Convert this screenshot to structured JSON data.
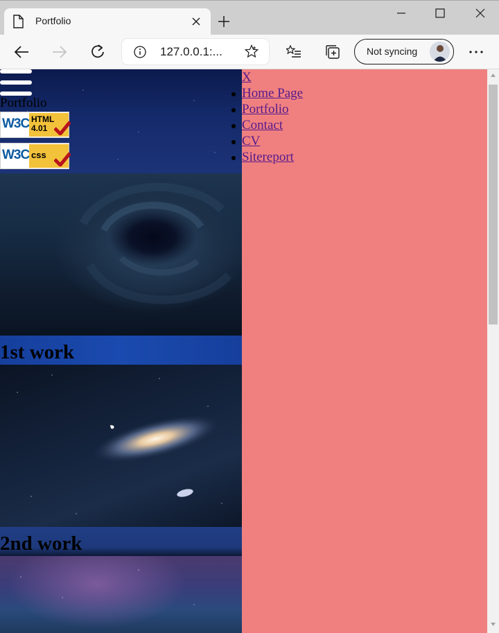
{
  "browser": {
    "tab_title": "Portfolio",
    "address": "127.0.0.1:...",
    "sync_label": "Not syncing",
    "icons": {
      "tab": "page-icon",
      "tab_close": "close-icon",
      "new_tab": "plus-icon",
      "minimize": "minimize-icon",
      "maximize": "maximize-icon",
      "close": "close-icon",
      "back": "back-arrow-icon",
      "forward": "forward-arrow-icon",
      "refresh": "refresh-icon",
      "info": "info-icon",
      "favorite": "star-icon",
      "favorites": "favorites-list-icon",
      "collections": "collections-icon",
      "menu": "more-icon"
    }
  },
  "page": {
    "brand": "Portfolio",
    "badges": [
      {
        "left": "W3C",
        "right": "HTML\n4.01"
      },
      {
        "left": "W3C",
        "right": "css"
      }
    ],
    "works": [
      {
        "title": "1st work"
      },
      {
        "title": "2nd work"
      }
    ],
    "menu": {
      "close_label": "X",
      "items": [
        {
          "label": "Home Page"
        },
        {
          "label": "Portfolio"
        },
        {
          "label": "Contact"
        },
        {
          "label": "CV"
        },
        {
          "label": "Sitereport"
        }
      ]
    },
    "colors": {
      "menu_background": "#f08080",
      "link": "#551a8b",
      "work_bar": "#1a4aaf"
    }
  }
}
